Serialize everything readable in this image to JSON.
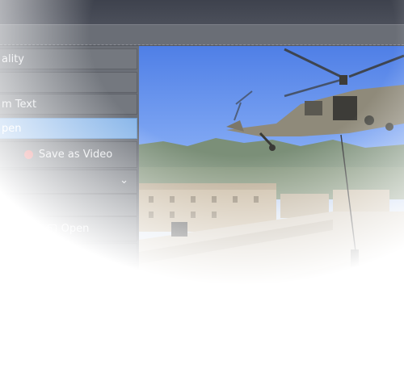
{
  "sidebar": {
    "quality_label": "ality",
    "custom_text_label": "m Text",
    "open_selected_label": "pen",
    "save_as_video_label": "Save as Video",
    "open_button_label": "Open"
  },
  "colors": {
    "selected_row": "#8cb8ea",
    "record_dot": "#e36b6b",
    "sky": "#5a8ae8"
  },
  "preview": {
    "subject": "helicopter-fast-rope-scene"
  }
}
